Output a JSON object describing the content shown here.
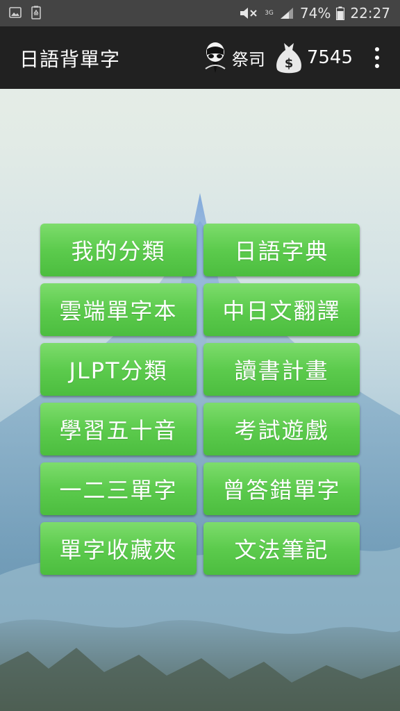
{
  "status_bar": {
    "network_type": "3G",
    "battery_percent": "74%",
    "time": "22:27",
    "icons": [
      "image-icon",
      "recycle-icon",
      "mute-icon",
      "signal-icon",
      "battery-icon"
    ]
  },
  "app_bar": {
    "title": "日語背單字",
    "user_name": "祭司",
    "coins": "7545",
    "icons": [
      "avatar-icon",
      "money-bag-icon",
      "more-vert-icon"
    ]
  },
  "menu": {
    "buttons": [
      {
        "label": "我的分類"
      },
      {
        "label": "日語字典"
      },
      {
        "label": "雲端單字本"
      },
      {
        "label": "中日文翻譯"
      },
      {
        "label": "JLPT分類"
      },
      {
        "label": "讀書計畫"
      },
      {
        "label": "學習五十音"
      },
      {
        "label": "考試遊戲"
      },
      {
        "label": "一二三單字"
      },
      {
        "label": "曾答錯單字"
      },
      {
        "label": "單字收藏夾"
      },
      {
        "label": "文法筆記"
      }
    ]
  },
  "colors": {
    "status_bar_bg": "#444444",
    "app_bar_bg": "#212121",
    "button_green": "#5ccb4d",
    "button_text": "#ffffff"
  }
}
